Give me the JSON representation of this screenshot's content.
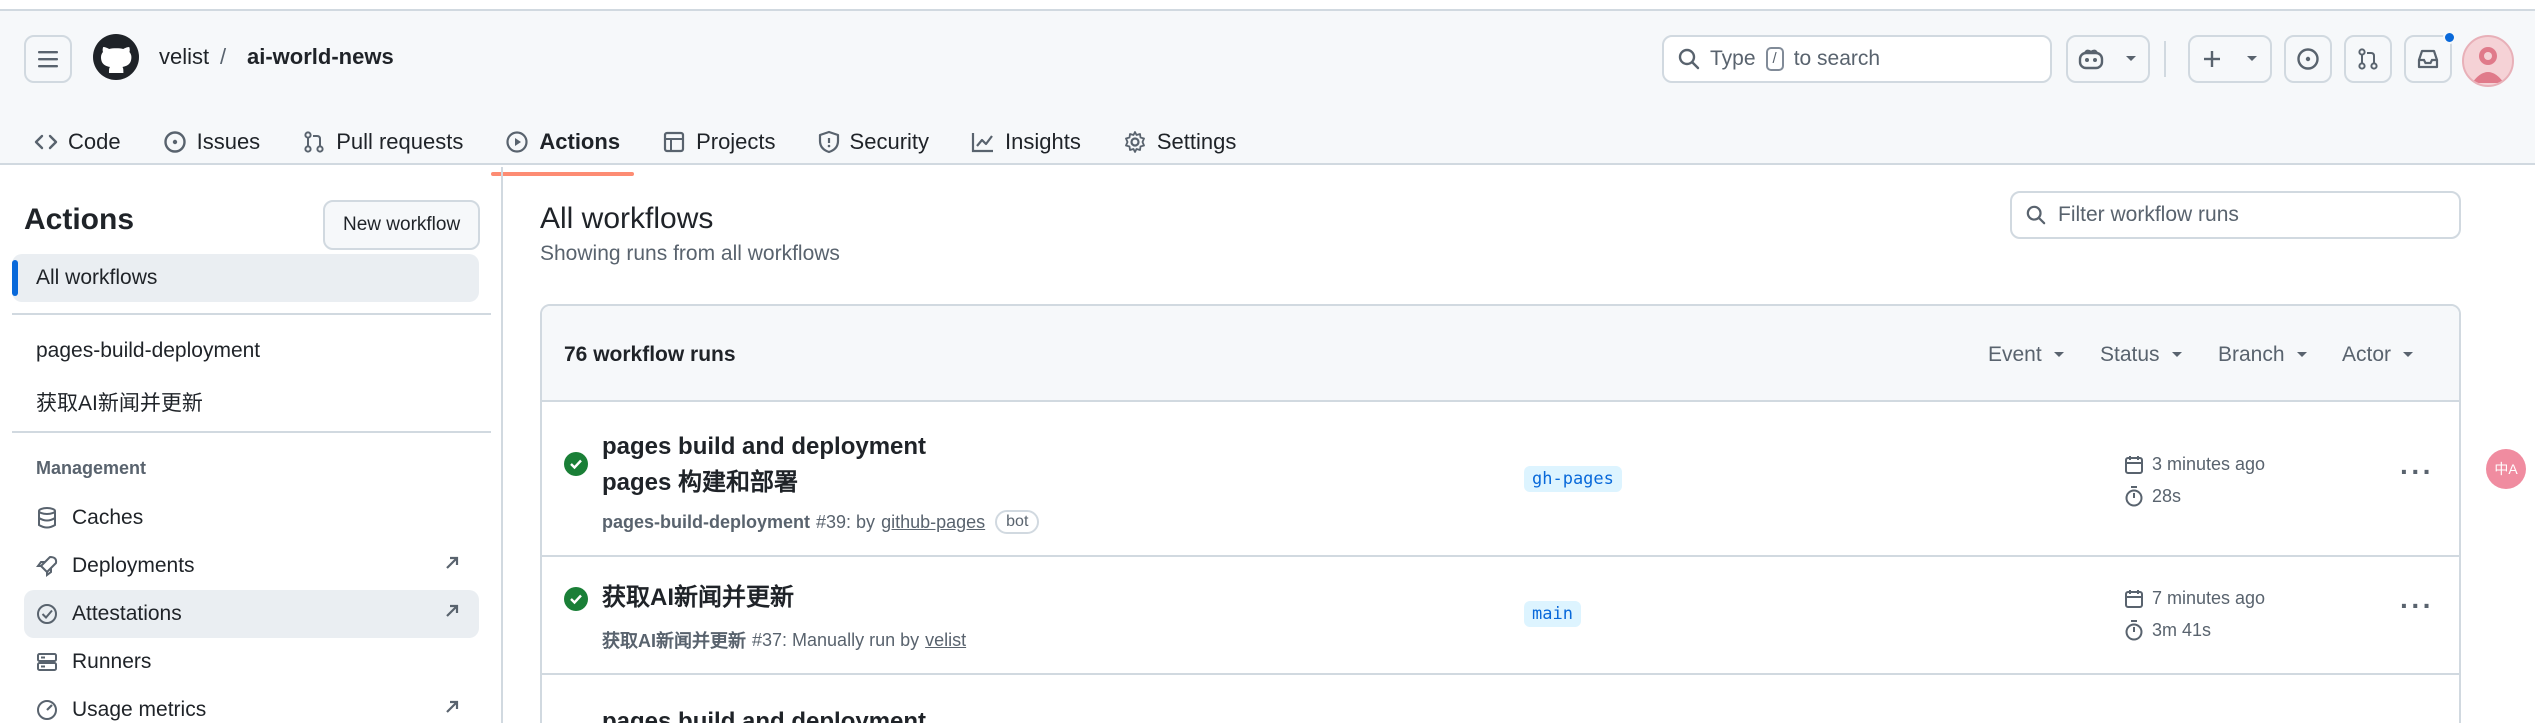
{
  "header": {
    "owner": "velist",
    "separator": "/",
    "repo": "ai-world-news",
    "search": {
      "prefix": "Type",
      "key": "/",
      "suffix": "to search"
    }
  },
  "tabs": [
    {
      "label": "Code",
      "icon": "code-icon"
    },
    {
      "label": "Issues",
      "icon": "issue-opened-icon"
    },
    {
      "label": "Pull requests",
      "icon": "git-pull-request-icon"
    },
    {
      "label": "Actions",
      "icon": "play-icon",
      "active": true
    },
    {
      "label": "Projects",
      "icon": "table-icon"
    },
    {
      "label": "Security",
      "icon": "shield-icon"
    },
    {
      "label": "Insights",
      "icon": "graph-icon"
    },
    {
      "label": "Settings",
      "icon": "gear-icon"
    }
  ],
  "sidebar": {
    "title": "Actions",
    "new_workflow": "New workflow",
    "selected": "All workflows",
    "workflows": [
      "pages-build-deployment",
      "获取AI新闻并更新"
    ],
    "management_label": "Management",
    "management": [
      {
        "label": "Caches",
        "icon": "database-icon"
      },
      {
        "label": "Deployments",
        "icon": "rocket-icon",
        "external": true
      },
      {
        "label": "Attestations",
        "icon": "verified-icon",
        "external": true
      },
      {
        "label": "Runners",
        "icon": "server-icon"
      },
      {
        "label": "Usage metrics",
        "icon": "meter-icon",
        "external": true
      }
    ]
  },
  "main": {
    "title": "All workflows",
    "subtitle": "Showing runs from all workflows",
    "filter_placeholder": "Filter workflow runs",
    "run_count": "76 workflow runs",
    "filters": [
      "Event",
      "Status",
      "Branch",
      "Actor"
    ],
    "runs": [
      {
        "title": "pages build and deployment",
        "title2": "pages 构建和部署",
        "workflow": "pages-build-deployment",
        "meta": "#39: by",
        "actor": "github-pages",
        "bot": "bot",
        "branch": "gh-pages",
        "when": "3 minutes ago",
        "duration": "28s"
      },
      {
        "title": "获取AI新闻并更新",
        "workflow": "获取AI新闻并更新",
        "meta": "#37: Manually run by",
        "actor": "velist",
        "branch": "main",
        "when": "7 minutes ago",
        "duration": "3m 41s"
      },
      {
        "title": "pages build and deployment"
      }
    ]
  },
  "colors": {
    "accent": "#0969da",
    "success": "#1a7f37",
    "tab_underline": "#fd8c73"
  },
  "translate_badge": "中A"
}
